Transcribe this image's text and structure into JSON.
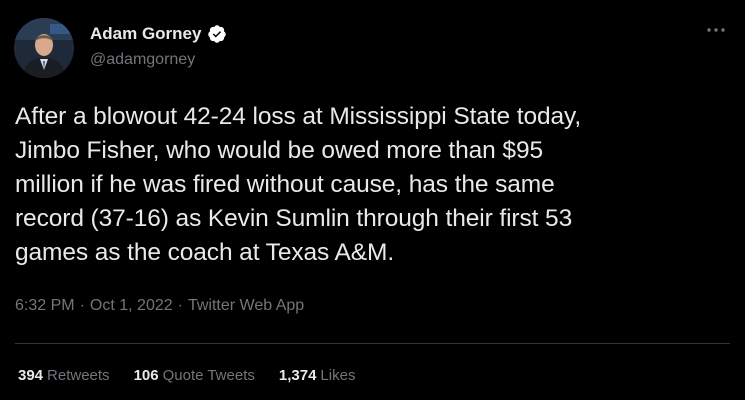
{
  "author": {
    "display_name": "Adam Gorney",
    "handle": "@adamgorney",
    "verified": true,
    "verified_color": "#ffffff"
  },
  "tweet": {
    "text": "After a blowout 42-24 loss at Mississippi State today,\nJimbo Fisher, who would be owed more than $95\nmillion if he was fired without cause, has the same\nrecord (37-16) as Kevin Sumlin through their first 53\ngames as the coach at Texas A&M."
  },
  "meta": {
    "time": "6:32 PM",
    "date": "Oct 1, 2022",
    "source": "Twitter Web App",
    "separator": "·"
  },
  "stats": {
    "retweets": {
      "count": "394",
      "label": "Retweets"
    },
    "quote_tweets": {
      "count": "106",
      "label": "Quote Tweets"
    },
    "likes": {
      "count": "1,374",
      "label": "Likes"
    }
  },
  "icons": {
    "more": "more-icon",
    "verified": "verified-badge-icon"
  },
  "colors": {
    "background": "#000000",
    "text": "#e7e9ea",
    "secondary": "#71767b",
    "divider": "#2f3336"
  }
}
